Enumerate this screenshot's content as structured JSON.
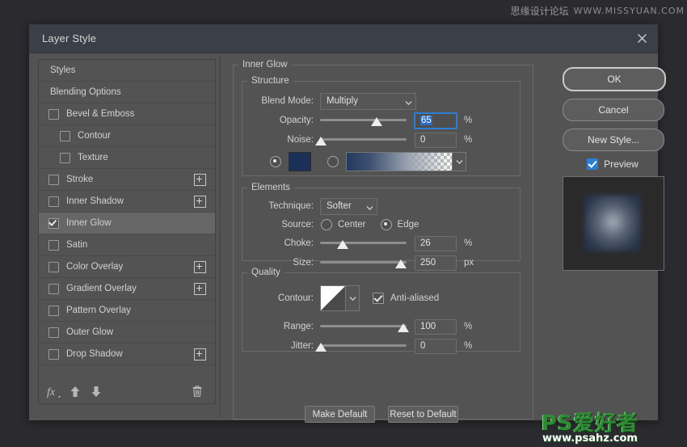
{
  "watermarks": {
    "top_cn": "思缘设计论坛",
    "top_url": "WWW.MISSYUAN.COM",
    "bottom_logo": "PS爱好者",
    "bottom_url": "www.psahz.com"
  },
  "dialog": {
    "title": "Layer Style",
    "close_icon": "✕"
  },
  "styles_panel": {
    "items": [
      {
        "label": "Styles",
        "type": "header",
        "checked": false,
        "indent": false,
        "plus": false,
        "selected": false
      },
      {
        "label": "Blending Options",
        "type": "header",
        "checked": false,
        "indent": false,
        "plus": false,
        "selected": false
      },
      {
        "label": "Bevel & Emboss",
        "type": "effect",
        "checked": false,
        "indent": false,
        "plus": false,
        "selected": false
      },
      {
        "label": "Contour",
        "type": "effect",
        "checked": false,
        "indent": true,
        "plus": false,
        "selected": false
      },
      {
        "label": "Texture",
        "type": "effect",
        "checked": false,
        "indent": true,
        "plus": false,
        "selected": false
      },
      {
        "label": "Stroke",
        "type": "effect",
        "checked": false,
        "indent": false,
        "plus": true,
        "selected": false
      },
      {
        "label": "Inner Shadow",
        "type": "effect",
        "checked": false,
        "indent": false,
        "plus": true,
        "selected": false
      },
      {
        "label": "Inner Glow",
        "type": "effect",
        "checked": true,
        "indent": false,
        "plus": false,
        "selected": true
      },
      {
        "label": "Satin",
        "type": "effect",
        "checked": false,
        "indent": false,
        "plus": false,
        "selected": false
      },
      {
        "label": "Color Overlay",
        "type": "effect",
        "checked": false,
        "indent": false,
        "plus": true,
        "selected": false
      },
      {
        "label": "Gradient Overlay",
        "type": "effect",
        "checked": false,
        "indent": false,
        "plus": true,
        "selected": false
      },
      {
        "label": "Pattern Overlay",
        "type": "effect",
        "checked": false,
        "indent": false,
        "plus": false,
        "selected": false
      },
      {
        "label": "Outer Glow",
        "type": "effect",
        "checked": false,
        "indent": false,
        "plus": false,
        "selected": false
      },
      {
        "label": "Drop Shadow",
        "type": "effect",
        "checked": false,
        "indent": false,
        "plus": true,
        "selected": false
      }
    ],
    "toolbar": {
      "fx_icon": "fx",
      "move_up_icon": "⬆",
      "move_down_icon": "⬇",
      "delete_icon": "🗑"
    }
  },
  "inner_glow": {
    "group_label": "Inner Glow",
    "structure": {
      "legend": "Structure",
      "blend_mode_label": "Blend Mode:",
      "blend_mode_value": "Multiply",
      "opacity_label": "Opacity:",
      "opacity_value": "65",
      "opacity_unit": "%",
      "noise_label": "Noise:",
      "noise_value": "0",
      "noise_unit": "%",
      "fill_type": "color",
      "color_hex": "#1b3057"
    },
    "elements": {
      "legend": "Elements",
      "technique_label": "Technique:",
      "technique_value": "Softer",
      "source_label": "Source:",
      "source_center_label": "Center",
      "source_edge_label": "Edge",
      "source_value": "Edge",
      "choke_label": "Choke:",
      "choke_value": "26",
      "choke_unit": "%",
      "size_label": "Size:",
      "size_value": "250",
      "size_unit": "px"
    },
    "quality": {
      "legend": "Quality",
      "contour_label": "Contour:",
      "anti_aliased_label": "Anti-aliased",
      "anti_aliased_checked": true,
      "range_label": "Range:",
      "range_value": "100",
      "range_unit": "%",
      "jitter_label": "Jitter:",
      "jitter_value": "0",
      "jitter_unit": "%"
    },
    "make_default_label": "Make Default",
    "reset_default_label": "Reset to Default"
  },
  "actions": {
    "ok_label": "OK",
    "cancel_label": "Cancel",
    "new_style_label": "New Style...",
    "preview_label": "Preview",
    "preview_checked": true
  }
}
